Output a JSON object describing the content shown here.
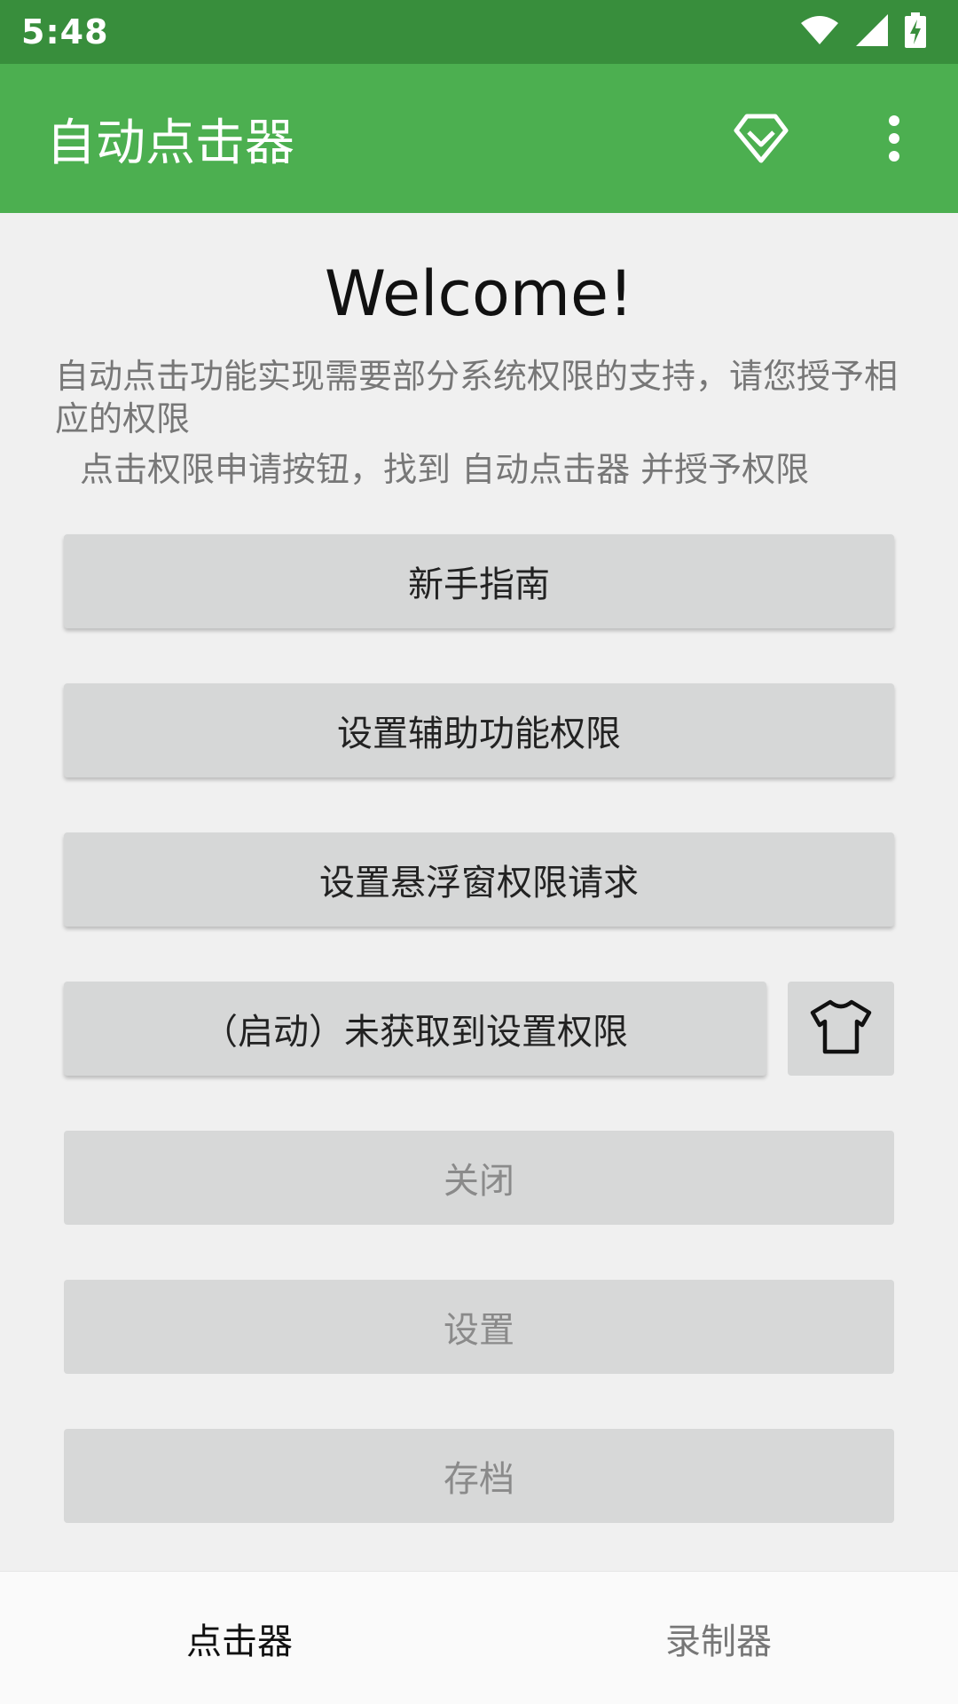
{
  "status_bar": {
    "time": "5:48"
  },
  "app_bar": {
    "title": "自动点击器"
  },
  "main": {
    "welcome": "Welcome!",
    "description": "自动点击功能实现需要部分系统权限的支持，请您授予相应的权限",
    "instruction": "点击权限申请按钮，找到 自动点击器 并授予权限",
    "buttons": {
      "guide": "新手指南",
      "accessibility": "设置辅助功能权限",
      "overlay": "设置悬浮窗权限请求",
      "start": "（启动）未获取到设置权限",
      "close": "关闭",
      "settings": "设置",
      "archive": "存档"
    }
  },
  "bottom_nav": {
    "clicker": "点击器",
    "recorder": "录制器"
  }
}
